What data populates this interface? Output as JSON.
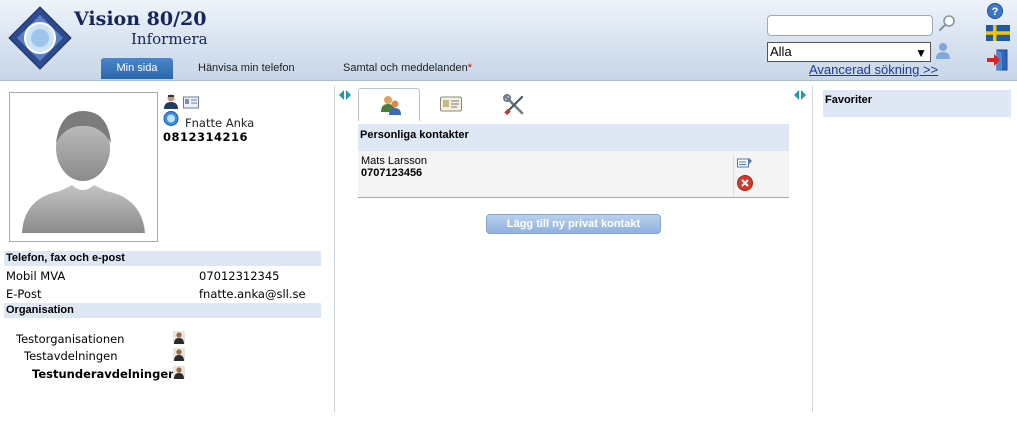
{
  "app": {
    "title": "Vision 80/20",
    "subtitle": "Informera"
  },
  "nav": {
    "tabs": [
      {
        "label": "Min sida",
        "active": true
      },
      {
        "label": "Hänvisa min telefon"
      },
      {
        "label": "Samtal och meddelanden",
        "marker": "*"
      }
    ]
  },
  "search": {
    "value": "",
    "scope": "Alla",
    "advanced_link": "Avancerad sökning >>"
  },
  "profile": {
    "name": "Fnatte Anka",
    "phone": "0812314216"
  },
  "contact_info": {
    "section_title": "Telefon, fax och e-post",
    "rows": [
      {
        "label": "Mobil MVA",
        "value": "07012312345"
      },
      {
        "label": "E-Post",
        "value": "fnatte.anka@sll.se"
      }
    ]
  },
  "organisation": {
    "section_title": "Organisation",
    "items": [
      "Testorganisationen",
      "Testavdelningen",
      "Testunderavdelningen"
    ]
  },
  "personal_contacts": {
    "title": "Personliga kontakter",
    "contacts": [
      {
        "name": "Mats Larsson",
        "phone": "0707123456"
      }
    ],
    "add_button": "Lägg till ny privat kontakt"
  },
  "favorites": {
    "title": "Favoriter"
  },
  "colors": {
    "header_top": "#eef3fa",
    "header_bottom": "#c8d6e8",
    "active_tab": "#2b66ad",
    "section_bg": "#dde8f4",
    "brand_navy": "#16255c",
    "link": "#1a3a9e"
  }
}
